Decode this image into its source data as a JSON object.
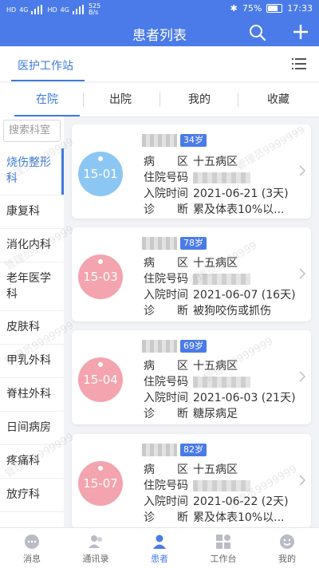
{
  "statusbar": {
    "left_a": "HD",
    "left_b": "4G",
    "left_c": "HD",
    "left_d": "4G",
    "speed": "525\nB/s",
    "battery": "75%",
    "time": "17:33"
  },
  "header": {
    "title": "患者列表"
  },
  "workstation": {
    "label": "医护工作站"
  },
  "tabs": [
    "在院",
    "出院",
    "我的",
    "收藏"
  ],
  "sidebar": {
    "search_placeholder": "搜索科室",
    "departments": [
      "烧伤整形科",
      "康复科",
      "消化内科",
      "老年医学科",
      "皮肤科",
      "甲乳外科",
      "脊柱外科",
      "日间病房",
      "疼痛科",
      "放疗科"
    ]
  },
  "labels": {
    "ward": "病　　区",
    "admission_no": "住院号码",
    "admit_time": "入院时间",
    "diagnosis": "诊　　断"
  },
  "patients": [
    {
      "bed": "15-01",
      "age": "34岁",
      "ward": "十五病区",
      "admit_time": "2021-06-21 (3天)",
      "diagnosis": "累及体表10%以...",
      "color": "#8cc7f3"
    },
    {
      "bed": "15-03",
      "age": "78岁",
      "ward": "十五病区",
      "admit_time": "2021-06-07 (16天)",
      "diagnosis": "被狗咬伤或抓伤",
      "color": "#f3a4ae"
    },
    {
      "bed": "15-04",
      "age": "69岁",
      "ward": "十五病区",
      "admit_time": "2021-06-03 (21天)",
      "diagnosis": "糖尿病足",
      "color": "#f3a4ae"
    },
    {
      "bed": "15-07",
      "age": "82岁",
      "ward": "十五病区",
      "admit_time": "2021-06-22 (2天)",
      "diagnosis": "累及体表10%以...",
      "color": "#f3a4ae"
    }
  ],
  "watermark": "管理员9999999",
  "bottomnav": [
    "消息",
    "通讯录",
    "患者",
    "工作台",
    "我的"
  ],
  "colors": {
    "accent": "#4b7be8",
    "active_text": "#3f7ad9"
  }
}
